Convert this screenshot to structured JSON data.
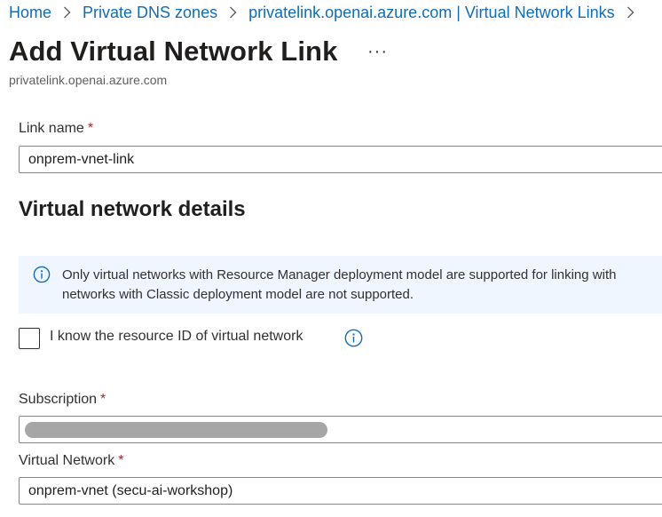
{
  "breadcrumb": {
    "items": [
      {
        "label": "Home"
      },
      {
        "label": "Private DNS zones"
      },
      {
        "label": "privatelink.openai.azure.com | Virtual Network Links"
      }
    ]
  },
  "header": {
    "title": "Add Virtual Network Link",
    "more_label": "···",
    "subtitle": "privatelink.openai.azure.com"
  },
  "form": {
    "link_name": {
      "label": "Link name",
      "required_mark": "*",
      "value": "onprem-vnet-link"
    },
    "section_title": "Virtual network details",
    "info": {
      "line1": "Only virtual networks with Resource Manager deployment model are supported for linking with",
      "line2": "networks with Classic deployment model are not supported."
    },
    "resource_id_checkbox": {
      "label": "I know the resource ID of virtual network",
      "checked": false
    },
    "subscription": {
      "label": "Subscription",
      "required_mark": "*",
      "value_redacted": true
    },
    "virtual_network": {
      "label": "Virtual Network",
      "required_mark": "*",
      "value": "onprem-vnet (secu-ai-workshop)"
    }
  },
  "colors": {
    "link": "#0f6cbd",
    "info_background": "#f0f6ff",
    "info_icon": "#0f6cbd",
    "required": "#a4262c"
  },
  "icons": [
    "chevron-right-icon",
    "info-icon",
    "help-info-icon"
  ]
}
